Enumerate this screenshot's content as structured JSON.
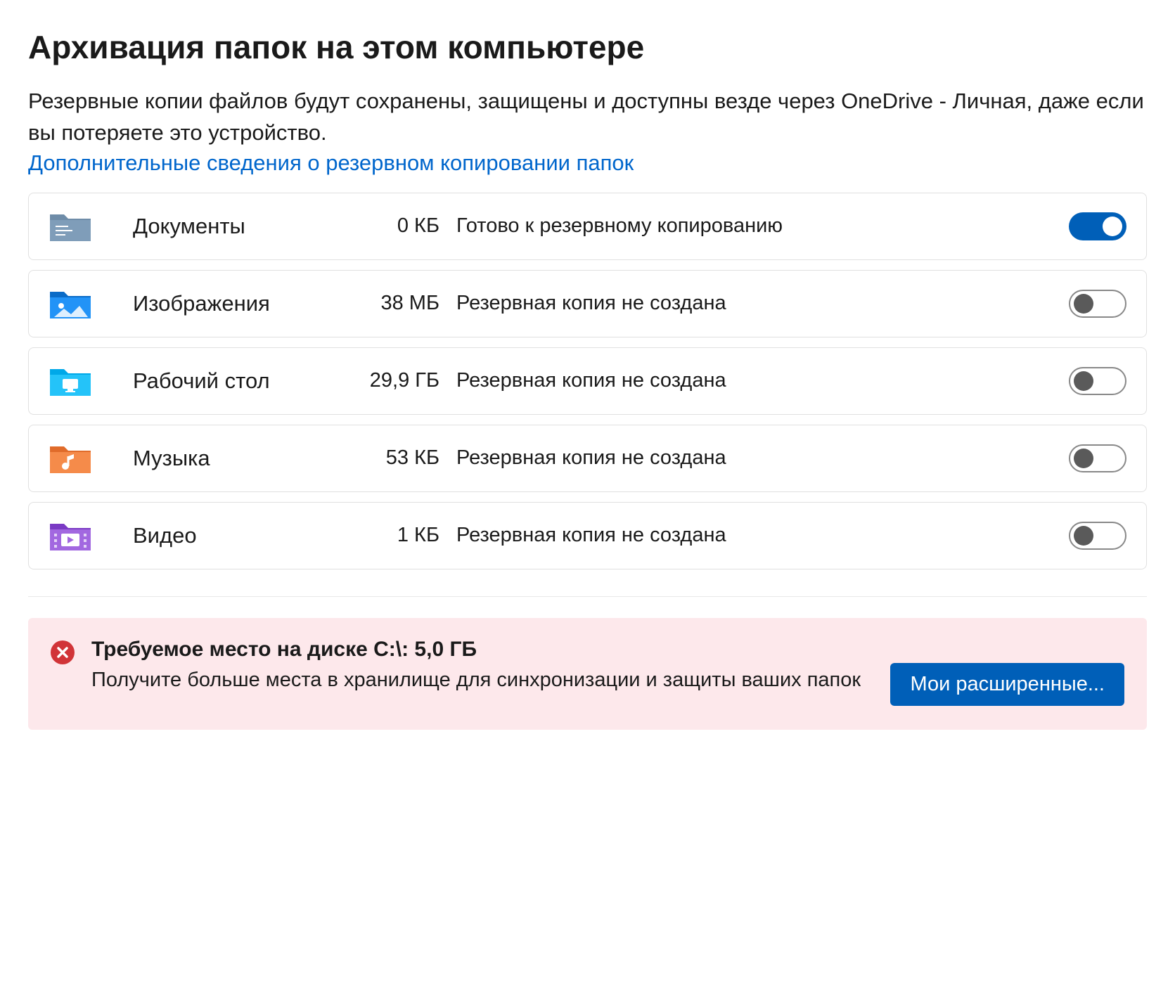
{
  "title": "Архивация папок на этом компьютере",
  "description": "Резервные копии файлов будут сохранены, защищены и доступны везде через OneDrive - Личная, даже если вы потеряете это устройство.",
  "link_text": "Дополнительные сведения о резервном копировании папок",
  "folders": [
    {
      "name": "Документы",
      "size": "0 КБ",
      "status": "Готово к резервному копированию",
      "toggle": true,
      "icon": "documents"
    },
    {
      "name": "Изображения",
      "size": "38 МБ",
      "status": "Резервная копия не создана",
      "toggle": false,
      "icon": "pictures"
    },
    {
      "name": "Рабочий стол",
      "size": "29,9 ГБ",
      "status": "Резервная копия не создана",
      "toggle": false,
      "icon": "desktop"
    },
    {
      "name": "Музыка",
      "size": "53 КБ",
      "status": "Резервная копия не создана",
      "toggle": false,
      "icon": "music"
    },
    {
      "name": "Видео",
      "size": "1 КБ",
      "status": "Резервная копия не создана",
      "toggle": false,
      "icon": "videos"
    }
  ],
  "warning": {
    "title": "Требуемое место на диске C:\\: 5,0 ГБ",
    "description": "Получите больше места в хранилище для синхронизации и защиты ваших папок",
    "button": "Мои расширенные..."
  }
}
